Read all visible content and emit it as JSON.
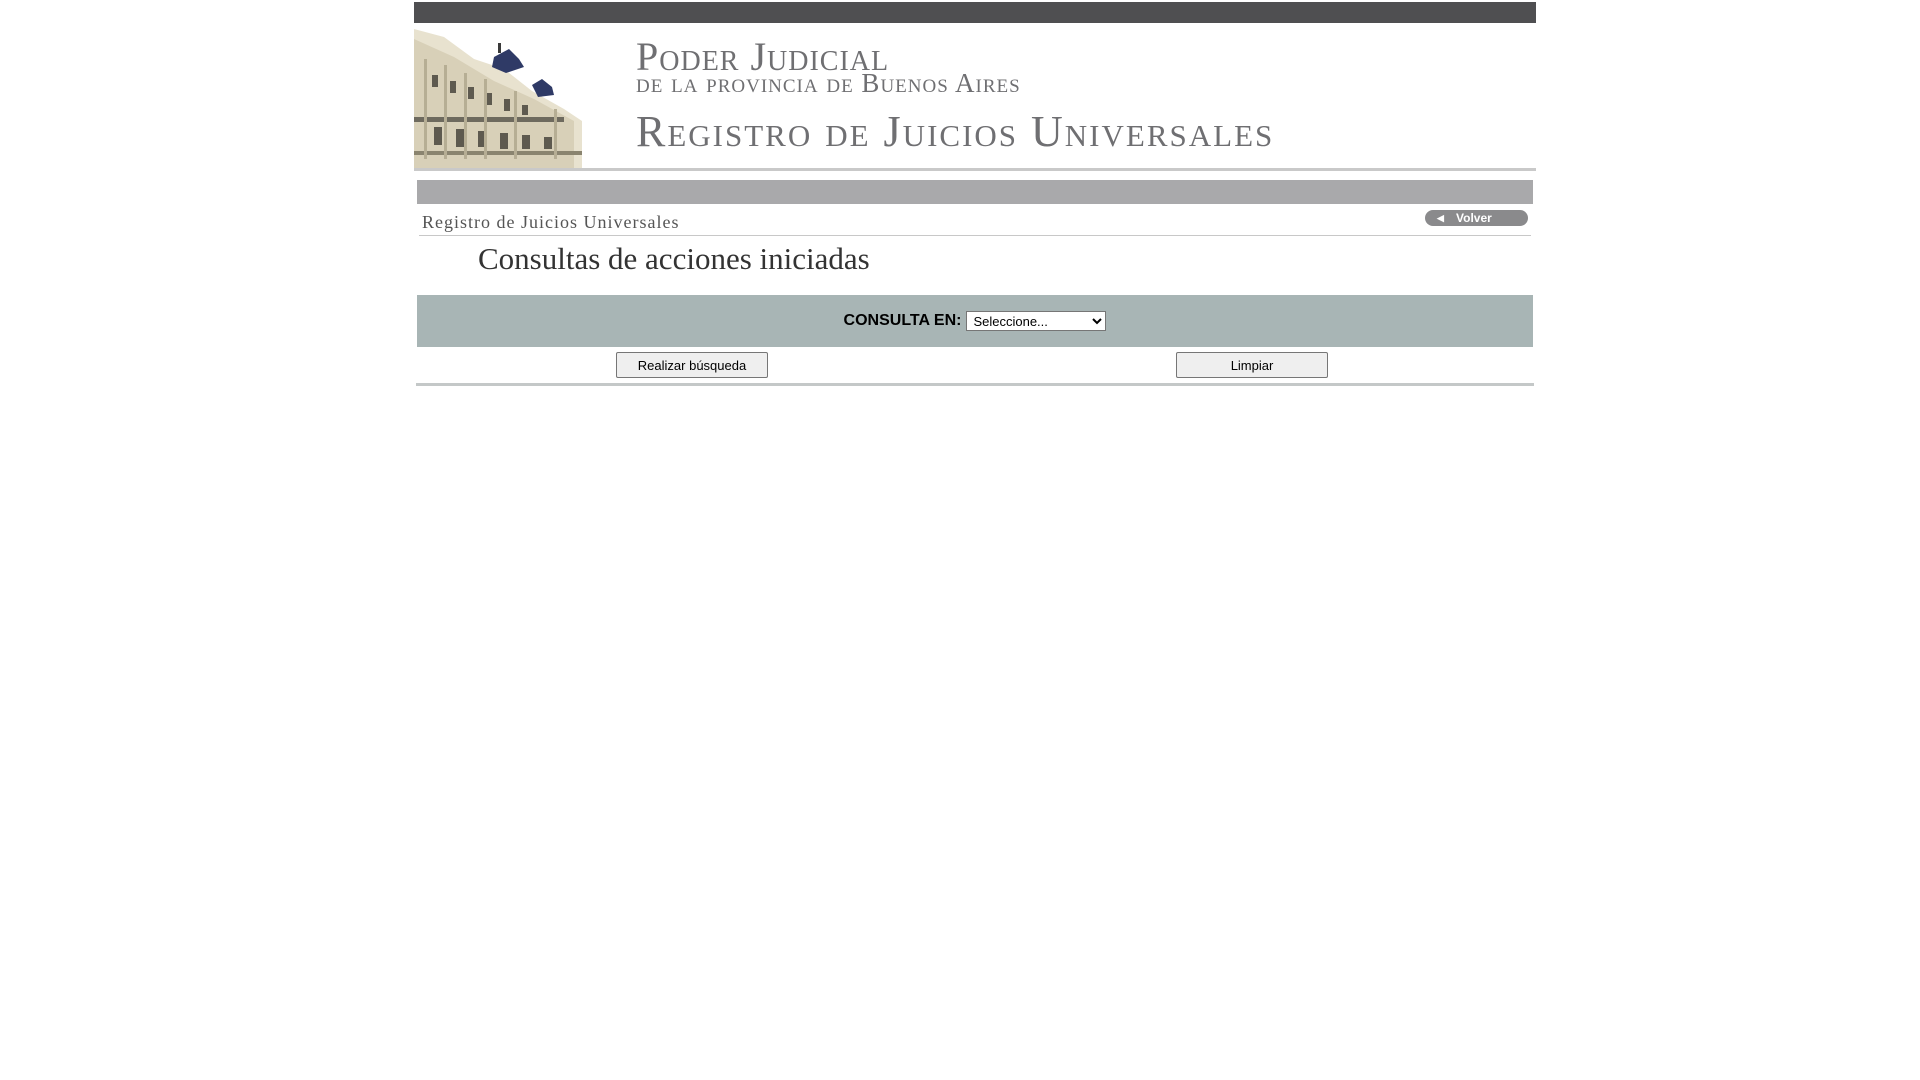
{
  "header": {
    "brand_line_1": "Poder Judicial",
    "brand_line_2": "de la provincia de Buenos Aires",
    "brand_line_3": "Registro de Juicios Universales",
    "building_icon": "courthouse-building-image"
  },
  "nav": {
    "breadcrumb": "Registro de Juicios Universales",
    "back_label": "Volver",
    "back_icon": "triangle-left-icon"
  },
  "main": {
    "title": "Consultas de acciones iniciadas",
    "query": {
      "label": "CONSULTA EN:",
      "selected": "Seleccione..."
    },
    "search_button": "Realizar búsqueda",
    "clear_button": "Limpiar"
  },
  "colors": {
    "top_bar": "#4f4f51",
    "nav_strip": "#a9a9ab",
    "query_band": "#a8b5b5",
    "brand_text": "#6f6f72"
  }
}
